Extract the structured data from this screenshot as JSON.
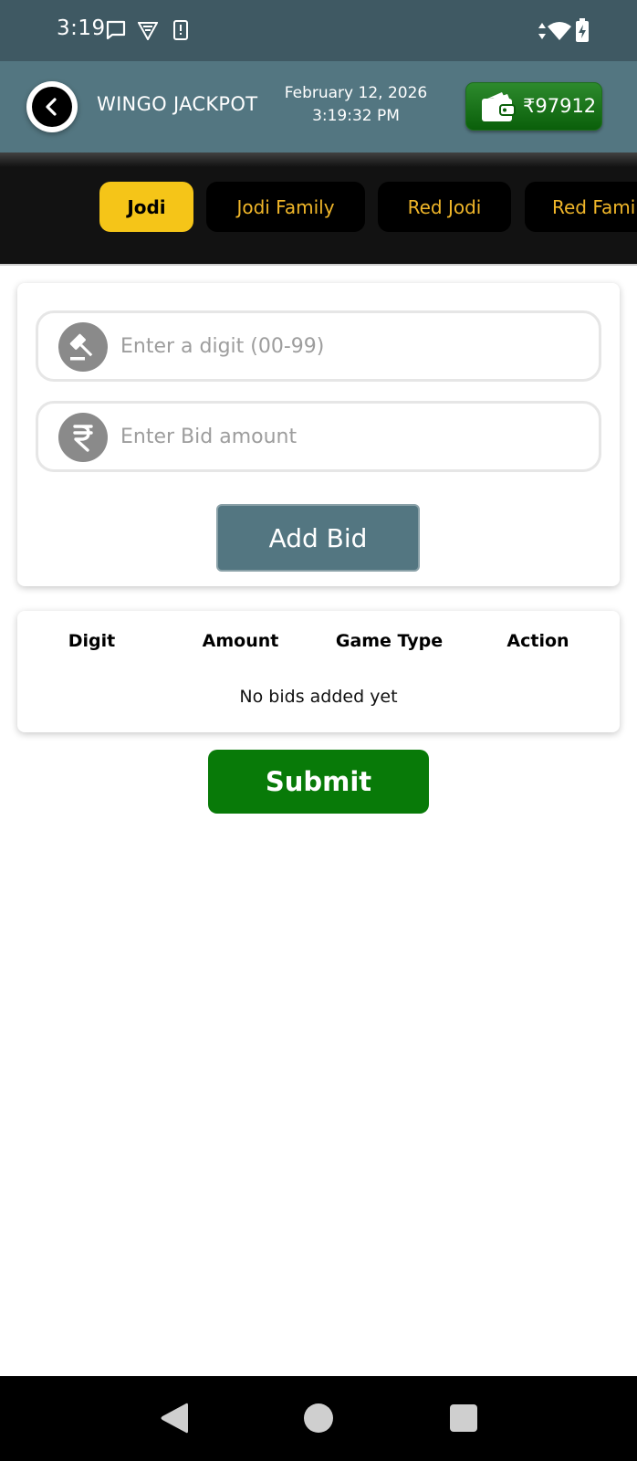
{
  "status_bar": {
    "time": "3:19",
    "icons": [
      "message-icon",
      "vpn-shield-icon",
      "sim-alert-icon",
      "data-arrows-icon",
      "wifi-icon",
      "battery-charging-icon"
    ]
  },
  "header": {
    "title": "WINGO JACKPOT",
    "date": "February 12, 2026",
    "time": "3:19:32 PM",
    "wallet_balance": "₹97912"
  },
  "tabs": [
    {
      "label": "Jodi",
      "active": true
    },
    {
      "label": "Jodi Family",
      "active": false
    },
    {
      "label": "Red Jodi",
      "active": false
    },
    {
      "label": "Red Family",
      "active": false
    }
  ],
  "form": {
    "digit_placeholder": "Enter a digit (00-99)",
    "amount_placeholder": "Enter Bid amount",
    "add_bid_label": "Add Bid"
  },
  "bids_table": {
    "columns": [
      "Digit",
      "Amount",
      "Game Type",
      "Action"
    ],
    "empty_message": "No bids added yet"
  },
  "submit_label": "Submit",
  "colors": {
    "status_bar": "#3f5963",
    "app_bar": "#537681",
    "tab_bar": "#121212",
    "tab_active": "#f5c518",
    "tab_text": "#f0b629",
    "wallet_green": "#0a5f0a",
    "submit_green": "#087a08"
  }
}
